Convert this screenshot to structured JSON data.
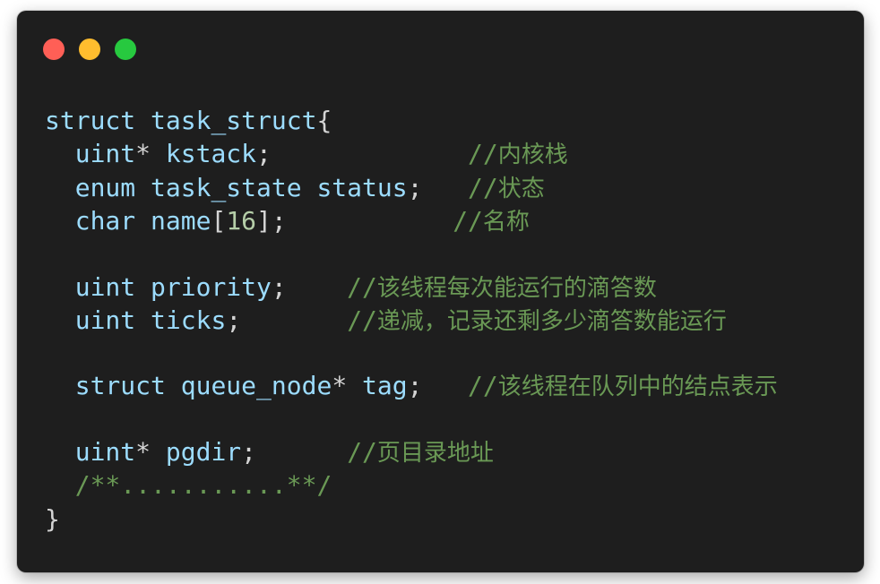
{
  "window": {
    "buttons": {
      "close": "close",
      "minimize": "minimize",
      "zoom": "zoom"
    }
  },
  "code": {
    "line1": {
      "kw": "struct",
      "name": "task_struct",
      "brace": "{"
    },
    "line2": {
      "type": "uint",
      "star": "*",
      "id": "kstack",
      "semi": ";",
      "comment_slashes": "//",
      "comment_text": "内核栈"
    },
    "line3": {
      "kw": "enum",
      "type": "task_state",
      "id": "status",
      "semi": ";",
      "comment_slashes": "//",
      "comment_text": "状态"
    },
    "line4": {
      "type": "char",
      "id": "name",
      "lb": "[",
      "num": "16",
      "rb": "]",
      "semi": ";",
      "comment_slashes": "//",
      "comment_text": "名称"
    },
    "line5": {
      "type": "uint",
      "id": "priority",
      "semi": ";",
      "comment_slashes": "//",
      "comment_text": "该线程每次能运行的滴答数"
    },
    "line6": {
      "type": "uint",
      "id": "ticks",
      "semi": ";",
      "comment_slashes": "//",
      "comment_text": "递减，记录还剩多少滴答数能运行"
    },
    "line7": {
      "kw": "struct",
      "type": "queue_node",
      "star": "*",
      "id": "tag",
      "semi": ";",
      "comment_slashes": "//",
      "comment_text": "该线程在队列中的结点表示"
    },
    "line8": {
      "type": "uint",
      "star": "*",
      "id": "pgdir",
      "semi": ";",
      "comment_slashes": "//",
      "comment_text": "页目录地址"
    },
    "line9": {
      "comment": "/**...........**/"
    },
    "line10": {
      "brace": "}"
    }
  }
}
